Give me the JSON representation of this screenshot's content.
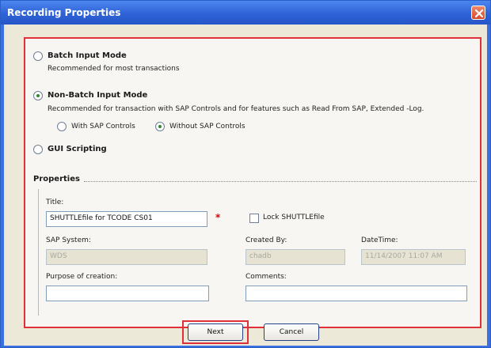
{
  "window": {
    "title": "Recording Properties"
  },
  "modes": {
    "batch": {
      "label": "Batch Input Mode",
      "description": "Recommended for most transactions"
    },
    "non_batch": {
      "label": "Non-Batch Input Mode",
      "description": "Recommended for transaction with SAP Controls and for features such as Read From SAP, Extended -Log.",
      "sub_options": {
        "with": "With SAP Controls",
        "without": "Without SAP Controls"
      }
    },
    "gui": {
      "label": "GUI Scripting"
    }
  },
  "properties": {
    "section_title": "Properties",
    "title_label": "Title:",
    "title_value": "SHUTTLEfile for TCODE CS01",
    "lock_label": "Lock SHUTTLEfile",
    "sap_system_label": "SAP System:",
    "sap_system_value": "WDS",
    "created_by_label": "Created By:",
    "created_by_value": "chadb",
    "datetime_label": "DateTime:",
    "datetime_value": "11/14/2007 11:07 AM",
    "purpose_label": "Purpose of creation:",
    "purpose_value": "",
    "comments_label": "Comments:",
    "comments_value": ""
  },
  "buttons": {
    "next": "Next",
    "cancel": "Cancel"
  },
  "state": {
    "selected_mode": "Non-Batch Input Mode",
    "selected_sub_option": "Without SAP Controls",
    "lock_checked": false
  },
  "colors": {
    "title_bar": "#2f62d6",
    "highlight": "#e0303a"
  }
}
